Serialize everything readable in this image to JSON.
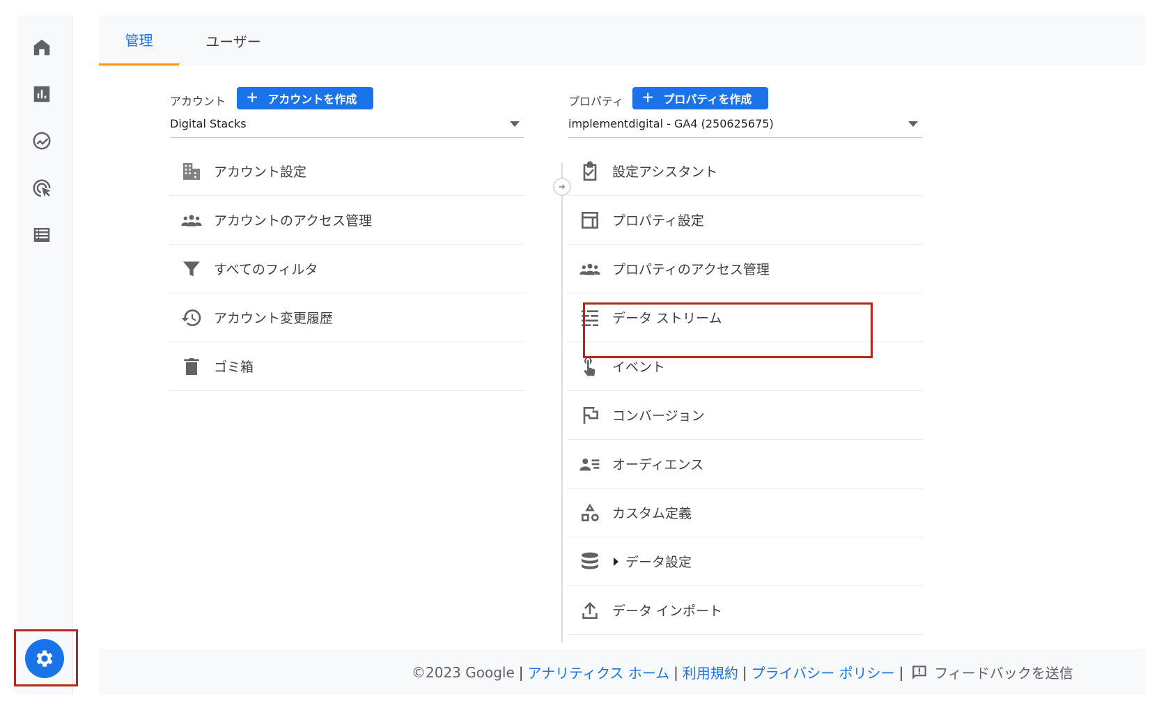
{
  "tabs": {
    "admin": "管理",
    "users": "ユーザー"
  },
  "account": {
    "label": "アカウント",
    "create_button": "アカウントを作成",
    "selected": "Digital Stacks",
    "items": [
      {
        "label": "アカウント設定",
        "icon": "building-icon"
      },
      {
        "label": "アカウントのアクセス管理",
        "icon": "people-icon"
      },
      {
        "label": "すべてのフィルタ",
        "icon": "filter-icon"
      },
      {
        "label": "アカウント変更履歴",
        "icon": "history-icon"
      },
      {
        "label": "ゴミ箱",
        "icon": "trash-icon"
      }
    ]
  },
  "property": {
    "label": "プロパティ",
    "create_button": "プロパティを作成",
    "selected": "implementdigital - GA4 (250625675)",
    "items": [
      {
        "label": "設定アシスタント",
        "icon": "clipboard-check-icon"
      },
      {
        "label": "プロパティ設定",
        "icon": "layout-icon"
      },
      {
        "label": "プロパティのアクセス管理",
        "icon": "people-icon"
      },
      {
        "label": "データ ストリーム",
        "icon": "data-streams-icon"
      },
      {
        "label": "イベント",
        "icon": "touch-icon"
      },
      {
        "label": "コンバージョン",
        "icon": "flag-icon"
      },
      {
        "label": "オーディエンス",
        "icon": "audience-icon"
      },
      {
        "label": "カスタム定義",
        "icon": "shapes-icon"
      },
      {
        "label": "データ設定",
        "icon": "database-icon"
      },
      {
        "label": "データ インポート",
        "icon": "upload-icon"
      }
    ]
  },
  "footer": {
    "copyright": "©2023 Google",
    "analytics_home": "アナリティクス ホーム",
    "terms": "利用規約",
    "privacy": "プライバシー ポリシー",
    "feedback": "フィードバックを送信"
  },
  "colors": {
    "accent": "#1a73e8",
    "tab_underline": "#f29900",
    "highlight_border": "#b3261e"
  }
}
